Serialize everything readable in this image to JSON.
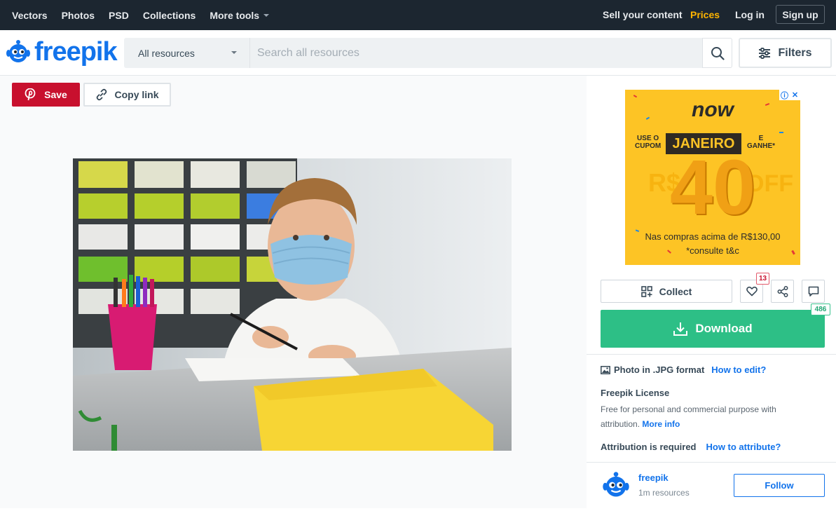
{
  "topbar": {
    "nav": [
      {
        "label": "Vectors"
      },
      {
        "label": "Photos"
      },
      {
        "label": "PSD"
      },
      {
        "label": "Collections"
      },
      {
        "label": "More tools"
      }
    ],
    "sell": "Sell your content",
    "prices": "Prices",
    "login": "Log in",
    "signup": "Sign up"
  },
  "header": {
    "logo": "freepik",
    "resource_select": "All resources",
    "search_placeholder": "Search all resources",
    "filters": "Filters"
  },
  "actions": {
    "save": "Save",
    "copy_link": "Copy link"
  },
  "ad": {
    "brand": "now",
    "line1_left": "USE O\nCUPOM",
    "code": "JANEIRO",
    "line1_right": "E\nGANHE*",
    "big_number": "40",
    "left_fade": "R$",
    "right_fade": "OFF",
    "terms1": "Nas compras acima de R$130,00",
    "terms2": "*consulte t&c"
  },
  "sidebar": {
    "collect": "Collect",
    "likes": "13",
    "downloads": "486",
    "download": "Download",
    "format": "Photo in .JPG format",
    "how_to_edit": "How to edit?",
    "license_title": "Freepik License",
    "license_desc": "Free for personal and commercial purpose with attribution.",
    "more_info": "More info",
    "attribution": "Attribution is required",
    "how_to_attribute": "How to attribute?",
    "author_name": "freepik",
    "author_resources": "1m resources",
    "follow": "Follow"
  },
  "colors": {
    "brand_blue": "#1273eb",
    "download_green": "#2dbf86",
    "save_red": "#c8102e",
    "prices_yellow": "#ffb400"
  }
}
